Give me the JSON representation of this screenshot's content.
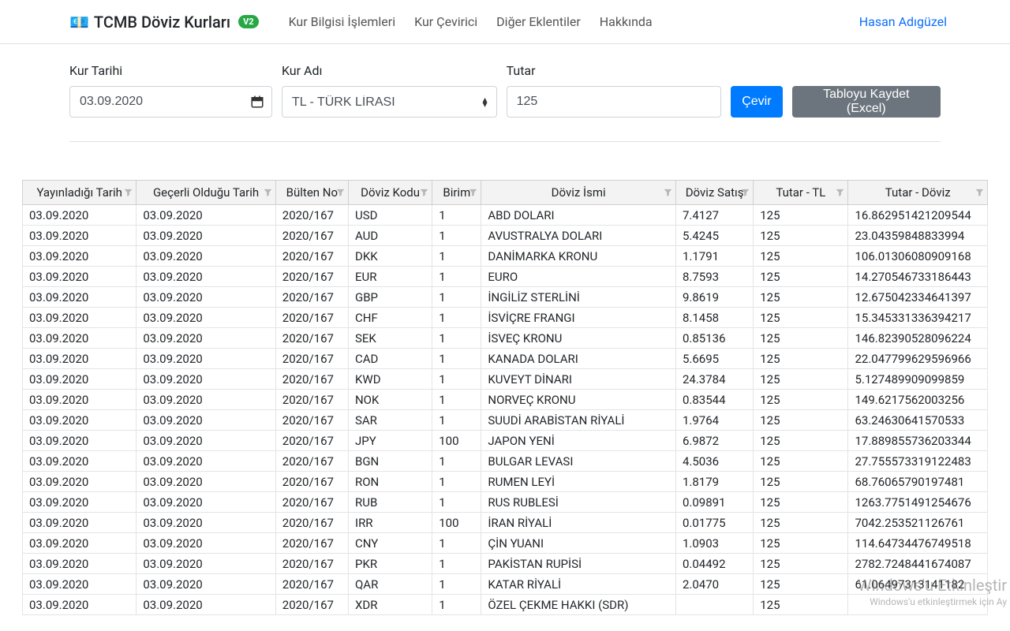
{
  "brand": {
    "emoji": "💶",
    "title": "TCMB Döviz Kurları",
    "badge": "V2"
  },
  "nav": {
    "items": [
      "Kur Bilgisi İşlemleri",
      "Kur Çevirici",
      "Diğer Eklentiler",
      "Hakkında"
    ],
    "user": "Hasan Adıgüzel"
  },
  "form": {
    "date_label": "Kur Tarihi",
    "date_value": "03.09.2020",
    "currency_label": "Kur Adı",
    "currency_value": "TL - TÜRK LİRASI",
    "amount_label": "Tutar",
    "amount_value": "125",
    "convert_label": "Çevir",
    "export_label": "Tabloyu Kaydet (Excel)"
  },
  "table": {
    "headers": [
      "Yayınladığı Tarih",
      "Geçerli Olduğu Tarih",
      "Bülten No",
      "Döviz Kodu",
      "Birim",
      "Döviz İsmi",
      "Döviz Satış",
      "Tutar - TL",
      "Tutar - Döviz"
    ],
    "rows": [
      [
        "03.09.2020",
        "03.09.2020",
        "2020/167",
        "USD",
        "1",
        "ABD DOLARI",
        "7.4127",
        "125",
        "16.862951421209544"
      ],
      [
        "03.09.2020",
        "03.09.2020",
        "2020/167",
        "AUD",
        "1",
        "AVUSTRALYA DOLARI",
        "5.4245",
        "125",
        "23.04359848833994"
      ],
      [
        "03.09.2020",
        "03.09.2020",
        "2020/167",
        "DKK",
        "1",
        "DANİMARKA KRONU",
        "1.1791",
        "125",
        "106.01306080909168"
      ],
      [
        "03.09.2020",
        "03.09.2020",
        "2020/167",
        "EUR",
        "1",
        "EURO",
        "8.7593",
        "125",
        "14.270546733186443"
      ],
      [
        "03.09.2020",
        "03.09.2020",
        "2020/167",
        "GBP",
        "1",
        "İNGİLİZ STERLİNİ",
        "9.8619",
        "125",
        "12.675042334641397"
      ],
      [
        "03.09.2020",
        "03.09.2020",
        "2020/167",
        "CHF",
        "1",
        "İSVİÇRE FRANGI",
        "8.1458",
        "125",
        "15.345331336394217"
      ],
      [
        "03.09.2020",
        "03.09.2020",
        "2020/167",
        "SEK",
        "1",
        "İSVEÇ KRONU",
        "0.85136",
        "125",
        "146.82390528096224"
      ],
      [
        "03.09.2020",
        "03.09.2020",
        "2020/167",
        "CAD",
        "1",
        "KANADA DOLARI",
        "5.6695",
        "125",
        "22.047799629596966"
      ],
      [
        "03.09.2020",
        "03.09.2020",
        "2020/167",
        "KWD",
        "1",
        "KUVEYT DİNARI",
        "24.3784",
        "125",
        "5.127489909099859"
      ],
      [
        "03.09.2020",
        "03.09.2020",
        "2020/167",
        "NOK",
        "1",
        "NORVEÇ KRONU",
        "0.83544",
        "125",
        "149.6217562003256"
      ],
      [
        "03.09.2020",
        "03.09.2020",
        "2020/167",
        "SAR",
        "1",
        "SUUDİ ARABİSTAN RİYALİ",
        "1.9764",
        "125",
        "63.24630641570533"
      ],
      [
        "03.09.2020",
        "03.09.2020",
        "2020/167",
        "JPY",
        "100",
        "JAPON YENİ",
        "6.9872",
        "125",
        "17.889855736203344"
      ],
      [
        "03.09.2020",
        "03.09.2020",
        "2020/167",
        "BGN",
        "1",
        "BULGAR LEVASI",
        "4.5036",
        "125",
        "27.755573319122483"
      ],
      [
        "03.09.2020",
        "03.09.2020",
        "2020/167",
        "RON",
        "1",
        "RUMEN LEYİ",
        "1.8179",
        "125",
        "68.76065790197481"
      ],
      [
        "03.09.2020",
        "03.09.2020",
        "2020/167",
        "RUB",
        "1",
        "RUS RUBLESİ",
        "0.09891",
        "125",
        "1263.7751491254676"
      ],
      [
        "03.09.2020",
        "03.09.2020",
        "2020/167",
        "IRR",
        "100",
        "İRAN RİYALİ",
        "0.01775",
        "125",
        "7042.253521126761"
      ],
      [
        "03.09.2020",
        "03.09.2020",
        "2020/167",
        "CNY",
        "1",
        "ÇİN YUANI",
        "1.0903",
        "125",
        "114.64734476749518"
      ],
      [
        "03.09.2020",
        "03.09.2020",
        "2020/167",
        "PKR",
        "1",
        "PAKİSTAN RUPİSİ",
        "0.04492",
        "125",
        "2782.7248441674087"
      ],
      [
        "03.09.2020",
        "03.09.2020",
        "2020/167",
        "QAR",
        "1",
        "KATAR RİYALİ",
        "2.0470",
        "125",
        "61.06497313141182"
      ],
      [
        "03.09.2020",
        "03.09.2020",
        "2020/167",
        "XDR",
        "1",
        "ÖZEL ÇEKME HAKKI (SDR)",
        "",
        "125",
        ""
      ]
    ]
  },
  "watermark": {
    "line1": "Windows'u Etkinleştir",
    "line2": "Windows'u etkinleştirmek için Ay"
  }
}
